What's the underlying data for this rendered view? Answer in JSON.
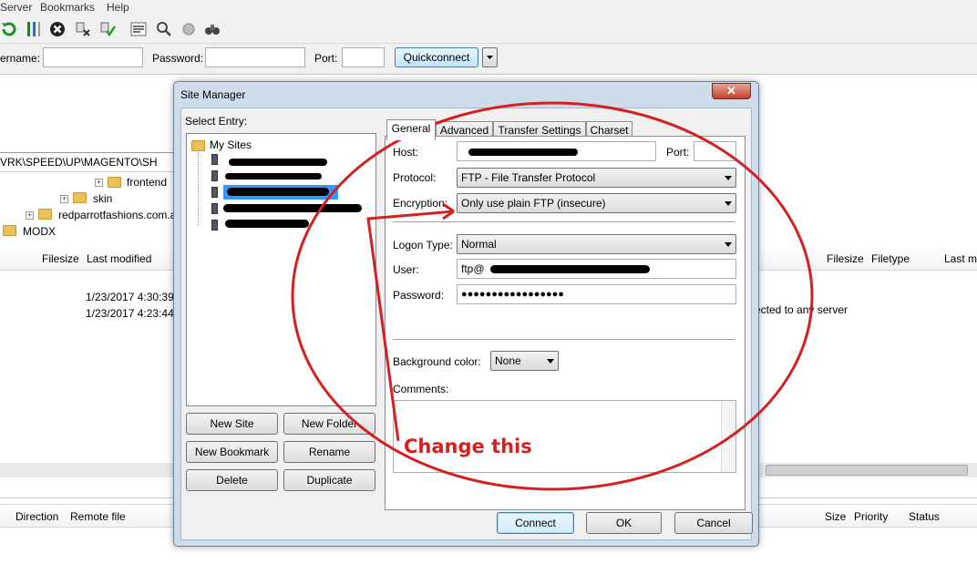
{
  "menu": [
    "Server",
    "Bookmarks",
    "Help"
  ],
  "quickconnect": {
    "username_label": "ername:",
    "password_label": "Password:",
    "port_label": "Port:",
    "button_label": "Quickconnect"
  },
  "local_panel": {
    "path": "VRK\\SPEED\\UP\\MAGENTO\\SH",
    "tree": [
      "frontend",
      "skin",
      "redparrotfashions.com.a",
      "MODX"
    ],
    "columns": [
      "Filesize",
      "Last modified"
    ],
    "files": [
      {
        "modified": "1/23/2017 4:30:39"
      },
      {
        "modified": "1/23/2017 4:23:44"
      }
    ]
  },
  "remote_panel": {
    "columns": [
      "Filesize",
      "Filetype",
      "Last m"
    ],
    "status_text": "ected to any server"
  },
  "queue": {
    "columns": [
      "Direction",
      "Remote file",
      "Size",
      "Priority",
      "Status"
    ]
  },
  "dialog": {
    "title": "Site Manager",
    "close_glyph": "✕",
    "select_entry_label": "Select Entry:",
    "root_folder": "My Sites",
    "buttons": {
      "new_site": "New Site",
      "new_folder": "New Folder",
      "new_bookmark": "New Bookmark",
      "rename": "Rename",
      "delete": "Delete",
      "duplicate": "Duplicate",
      "connect": "Connect",
      "ok": "OK",
      "cancel": "Cancel"
    },
    "tabs": [
      "General",
      "Advanced",
      "Transfer Settings",
      "Charset"
    ],
    "general": {
      "host_label": "Host:",
      "port_label": "Port:",
      "protocol_label": "Protocol:",
      "protocol_value": "FTP - File Transfer Protocol",
      "encryption_label": "Encryption:",
      "encryption_value": "Only use plain FTP (insecure)",
      "logon_type_label": "Logon Type:",
      "logon_type_value": "Normal",
      "user_label": "User:",
      "user_value": "ftp@",
      "password_label": "Password:",
      "password_value": "●●●●●●●●●●●●●●●●●",
      "bg_color_label": "Background color:",
      "bg_color_value": "None",
      "comments_label": "Comments:"
    }
  },
  "annotation": {
    "text": "Change this",
    "color": "#d42020"
  }
}
